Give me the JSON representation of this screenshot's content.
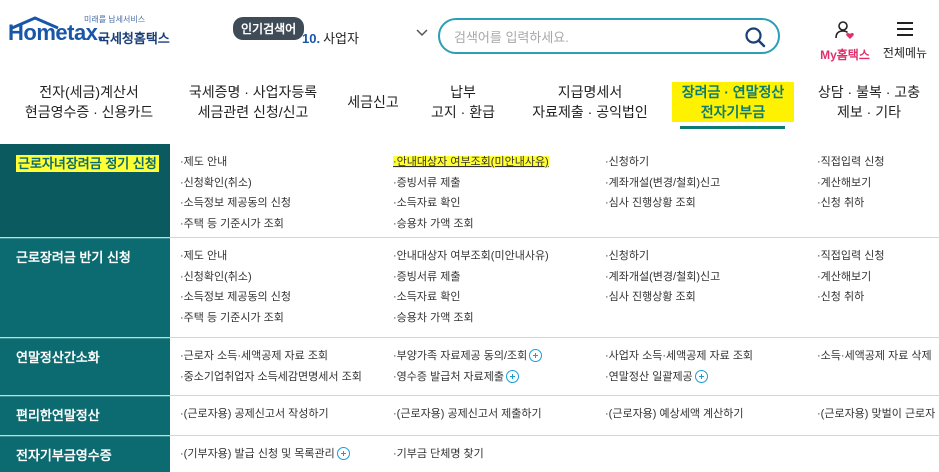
{
  "header": {
    "logo": {
      "tagline": "미래를 납세서비스",
      "brand": "Hometax.",
      "brand_sub": "국세청홈택스"
    },
    "popular": {
      "badge": "인기검색어",
      "rank": "10.",
      "term": "사업자"
    },
    "search": {
      "placeholder": "검색어를 입력하세요."
    },
    "my_label": "My홈택스",
    "all_menu_label": "전체메뉴"
  },
  "gnb": [
    {
      "line1": "전자(세금)계산서",
      "line2": "현금영수증 · 신용카드"
    },
    {
      "line1": "국세증명 · 사업자등록",
      "line2": "세금관련 신청/신고"
    },
    {
      "line1": "세금신고",
      "line2": ""
    },
    {
      "line1": "납부",
      "line2": "고지 · 환급"
    },
    {
      "line1": "지급명세서",
      "line2": "자료제출 · 공익법인"
    },
    {
      "line1": "장려금 · 연말정산",
      "line2": "전자기부금"
    },
    {
      "line1": "상담 · 불복 · 고충",
      "line2": "제보 · 기타"
    }
  ],
  "menu": {
    "rows": [
      {
        "category": "근로자녀장려금 정기 신청",
        "cols": [
          [
            "·제도 안내",
            "·신청확인(취소)",
            "·소득정보 제공동의 신청",
            "·주택 등 기준시가 조회"
          ],
          [
            "·안내대상자 여부조회(미안내사유)",
            "·증빙서류 제출",
            "·소득자료 확인",
            "·승용차 가액 조회"
          ],
          [
            "·신청하기",
            "·계좌개설(변경/철회)신고",
            "·심사 진행상황 조회"
          ],
          [
            "·직접입력 신청",
            "·계산해보기",
            "·신청 취하"
          ]
        ]
      },
      {
        "category": "근로장려금 반기 신청",
        "cols": [
          [
            "·제도 안내",
            "·신청확인(취소)",
            "·소득정보 제공동의 신청",
            "·주택 등 기준시가 조회"
          ],
          [
            "·안내대상자 여부조회(미안내사유)",
            "·증빙서류 제출",
            "·소득자료 확인",
            "·승용차 가액 조회"
          ],
          [
            "·신청하기",
            "·계좌개설(변경/철회)신고",
            "·심사 진행상황 조회"
          ],
          [
            "·직접입력 신청",
            "·계산해보기",
            "·신청 취하"
          ]
        ]
      },
      {
        "category": "연말정산간소화",
        "cols": [
          [
            "·근로자 소득·세액공제 자료 조회",
            "·중소기업취업자 소득세감면명세서 조회"
          ],
          [
            "·부양가족 자료제공 동의/조회",
            "·영수증 발급처 자료제출"
          ],
          [
            "·사업자 소득·세액공제 자료 조회",
            "·연말정산 일괄제공"
          ],
          [
            "·소득·세액공제 자료 삭제"
          ]
        ]
      },
      {
        "category": "편리한연말정산",
        "cols": [
          [
            "·(근로자용) 공제신고서 작성하기"
          ],
          [
            "·(근로자용) 공제신고서 제출하기"
          ],
          [
            "·(근로자용) 예상세액 계산하기"
          ],
          [
            "·(근로자용) 맞벌이 근로자"
          ]
        ]
      },
      {
        "category": "전자기부금영수증",
        "cols": [
          [
            "·(기부자용) 발급 신청 및 목록관리"
          ],
          [
            "·기부금 단체명 찾기"
          ],
          [],
          []
        ]
      }
    ]
  },
  "colors": {
    "teal": "#0c6b70",
    "accent": "#0c7b73",
    "highlight": "#ffff33",
    "search_border": "#2a9fb7",
    "my_pink": "#e0306a"
  }
}
